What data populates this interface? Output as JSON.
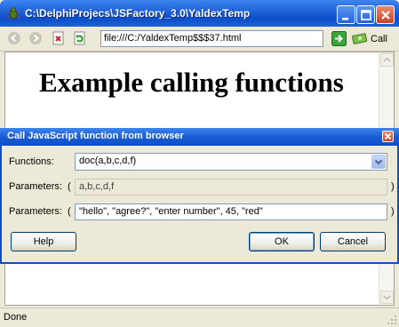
{
  "window": {
    "title": "C:\\DelphiProjecs\\JSFactory_3.0\\YaldexTemp",
    "app_icon": "bug-icon",
    "caption_buttons": [
      "minimize-icon",
      "maximize-icon",
      "close-icon"
    ]
  },
  "toolbar": {
    "buttons": [
      "back-icon",
      "forward-icon",
      "stop-icon",
      "refresh-icon"
    ],
    "url": "file:///C:/YaldexTemp$$$37.html",
    "go_icon": "go-arrow-icon",
    "call_label": "Call",
    "call_icon": "money-icon"
  },
  "page": {
    "heading": "Example calling functions"
  },
  "status": {
    "text": "Done"
  },
  "dialog": {
    "title": "Call JavaScript function from browser",
    "functions_label": "Functions:",
    "function_selected": "doc(a,b,c,d,f)",
    "params_label_1": "Parameters:",
    "params_value_1": "a,b,c,d,f",
    "params_label_2": "Parameters:",
    "params_value_2": "\"hello\", \"agree?\", \"enter number\", 45, \"red\"",
    "open_paren": "(",
    "close_paren": ")",
    "help_label": "Help",
    "ok_label": "OK",
    "cancel_label": "Cancel"
  },
  "colors": {
    "titlebar": "#0b4ec9",
    "face": "#ece9d8",
    "field_border": "#7f9db9"
  }
}
